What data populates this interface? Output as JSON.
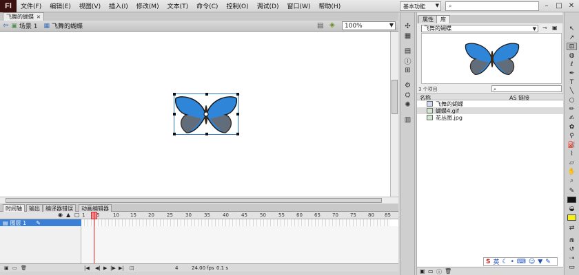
{
  "app": {
    "logo": "Fl",
    "menu": [
      "文件(F)",
      "编辑(E)",
      "视图(V)",
      "插入(I)",
      "修改(M)",
      "文本(T)",
      "命令(C)",
      "控制(O)",
      "调试(D)",
      "窗口(W)",
      "帮助(H)"
    ],
    "workspace": "基本功能",
    "window_controls": [
      "–",
      "□",
      "✕"
    ]
  },
  "document": {
    "tab_title": "飞舞的蝴蝶",
    "tab_close": "✕",
    "breadcrumb_scene": "场景 1",
    "breadcrumb_symbol": "飞舞的蝴蝶",
    "zoom": "100%"
  },
  "timeline": {
    "tabs": [
      "时间轴",
      "输出",
      "编译器错误",
      "动画编辑器"
    ],
    "ruler": [
      "1",
      "5",
      "10",
      "15",
      "20",
      "25",
      "30",
      "35",
      "40",
      "45",
      "50",
      "55",
      "60",
      "65",
      "70",
      "75",
      "80",
      "85"
    ],
    "layer_name": "图层 1",
    "footer_frame": "4",
    "footer_fps": "24.00",
    "footer_fps_unit": "fps",
    "footer_time": "0.1 s"
  },
  "library": {
    "tabs": [
      "属性",
      "库"
    ],
    "selected_doc": "飞舞的蝴蝶",
    "item_count": "3 个项目",
    "col_name": "名称",
    "col_linkage": "AS 链接",
    "items": [
      "飞舞的蝴蝶",
      "蝴蝶4.gif",
      "花丛图.jpg"
    ],
    "ime_label": "英"
  },
  "colors": {
    "accent": "#3c7fd6",
    "butterfly_blue": "#2f86d8",
    "stroke_swatch": "#111111",
    "fill_swatch": "#f5ef1a",
    "playhead": "#e02020"
  }
}
